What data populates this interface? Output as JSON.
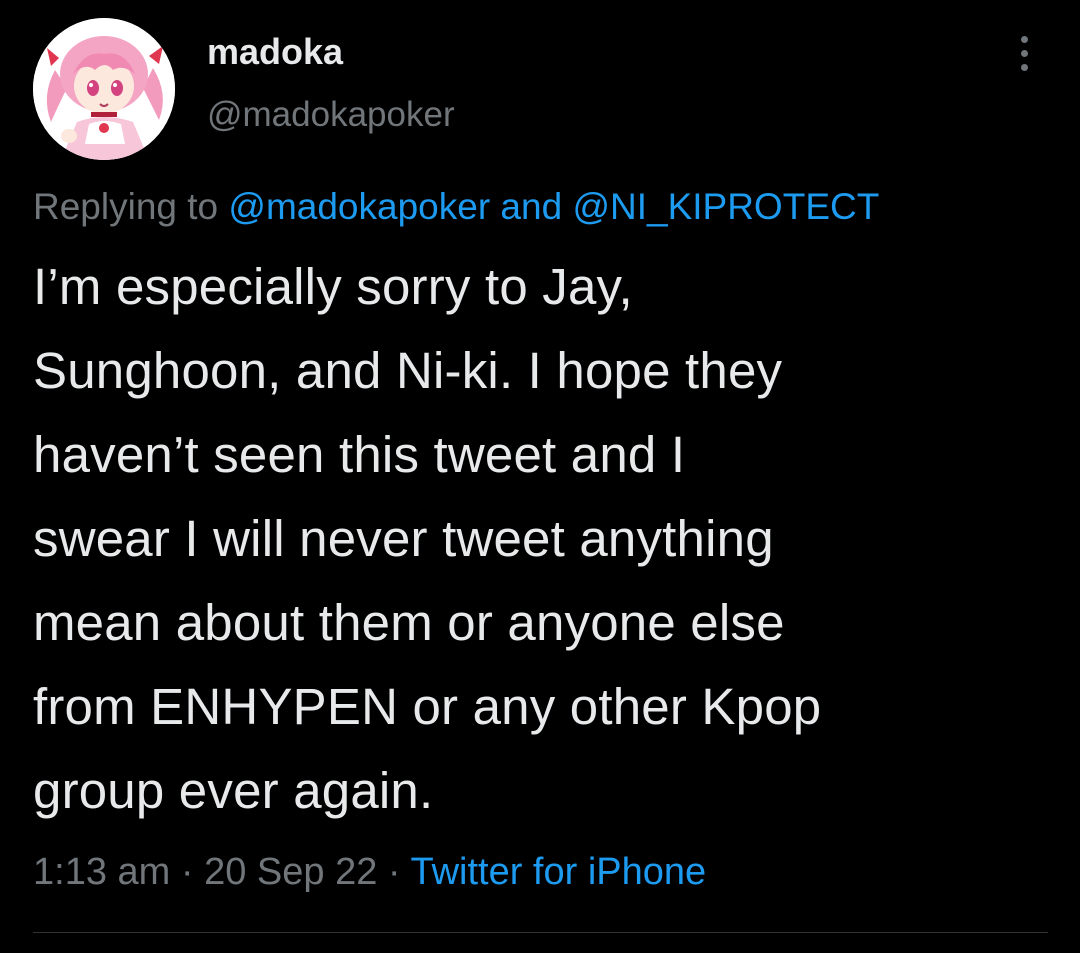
{
  "author": {
    "display_name": "madoka",
    "handle": "@madokapoker"
  },
  "reply": {
    "prefix": "Replying to ",
    "mention_1": "@madokapoker",
    "joiner": " and ",
    "mention_2": "@NI_KIPROTECT"
  },
  "tweet": {
    "lines": [
      "I’m especially sorry to Jay,",
      "Sunghoon, and Ni-ki. I hope they",
      "haven’t seen this tweet and I",
      "swear I will never tweet anything",
      "mean about them or anyone else",
      "from ENHYPEN or any other Kpop",
      "group ever again."
    ]
  },
  "meta": {
    "time": "1:13 am",
    "separator": " · ",
    "date": "20 Sep 22",
    "source": "Twitter for iPhone"
  },
  "icons": {
    "more": "more-vertical-icon",
    "avatar": "anime-character-avatar"
  },
  "colors": {
    "background": "#000000",
    "primary_text": "#e7e9ea",
    "secondary_text": "#71767b",
    "link": "#1d9bf0",
    "divider": "#2f3336"
  }
}
